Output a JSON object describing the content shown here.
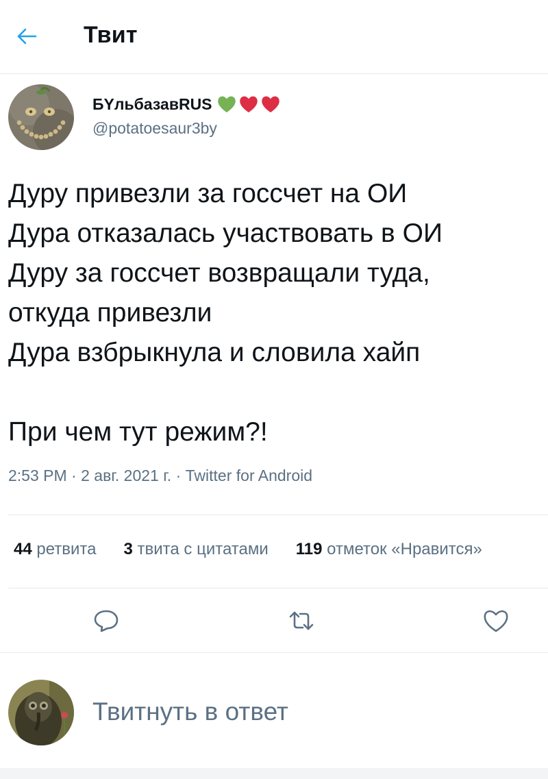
{
  "header": {
    "back_icon": "arrow-left-icon",
    "title": "Твит",
    "accent": "#1da1f2"
  },
  "author": {
    "display_name": "БYльбазавRUS",
    "handle": "@potatoesaur3by",
    "emoji": [
      "green-heart-icon",
      "red-heart-icon",
      "red-heart-icon"
    ],
    "emoji_colors": [
      "#77b255",
      "#dd2e44",
      "#dd2e44"
    ]
  },
  "tweet": {
    "lines": [
      "Дуру привезли за госсчет на ОИ",
      "Дура отказалась участвовать в ОИ",
      "Дуру за госсчет возвращали туда,",
      "откуда привезли",
      "Дура взбрыкнула и словила хайп",
      "",
      "При чем тут режим?!"
    ]
  },
  "meta": {
    "time": "2:53 PM",
    "date": "2 авг. 2021 г.",
    "source": "Twitter for Android"
  },
  "stats": [
    {
      "count": "44",
      "label": "ретвита"
    },
    {
      "count": "3",
      "label": "твита с цитатами"
    },
    {
      "count": "119",
      "label": "отметок «Нравится»"
    }
  ],
  "actions": [
    "reply-icon",
    "retweet-icon",
    "like-icon"
  ],
  "reply": {
    "placeholder": "Твитнуть в ответ"
  },
  "colors": {
    "text": "#0f1419",
    "secondary": "#5b7083",
    "divider": "#e6e9eb"
  }
}
